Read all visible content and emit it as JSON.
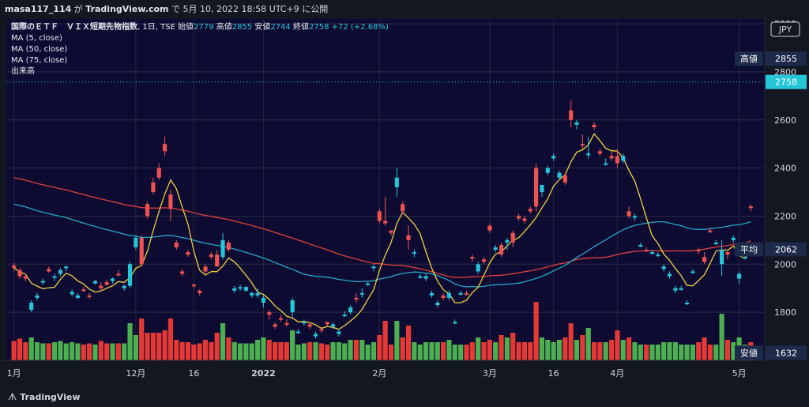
{
  "header": {
    "user": "masa117_114",
    "published_text_pre": "が",
    "site": "TradingView.com",
    "published_text_mid": "で",
    "datetime": "5月 10, 2022 18:58 UTC+9",
    "published_text_post": "に公開"
  },
  "legend": {
    "symbol": "国際のＥＴＦ　ＶＩＸ短期先物指数",
    "interval": "1日",
    "exchange": "TSE",
    "open_label": "始値",
    "open": "2779",
    "high_label": "高値",
    "high": "2855",
    "low_label": "安値",
    "low": "2744",
    "close_label": "終値",
    "close": "2758",
    "change": "+72 (+2.68%)",
    "ma_lines": [
      "MA (5, close)",
      "MA (50, close)",
      "MA (75, close)"
    ],
    "volume_label": "出来高"
  },
  "footer": {
    "brand": "TradingView"
  },
  "colors": {
    "bg": "#131722",
    "plot_bg": "#0e0b33",
    "up": "#26a69a",
    "up_candle": "#26c6da",
    "down": "#ef5350",
    "vol_up": "#4caf50",
    "vol_down": "#e53935",
    "ma5": "#f0d040",
    "ma50": "#26a6c9",
    "ma75": "#e0403c"
  },
  "chart_data": {
    "type": "candlestick",
    "title": "",
    "currency": "JPY",
    "y_ticks": [
      1800,
      2000,
      2200,
      2400,
      2600,
      2800,
      3000
    ],
    "ylim": [
      1600,
      3020
    ],
    "x_labels": [
      {
        "label": "1月",
        "index": 0
      },
      {
        "label": "12月",
        "index": 21
      },
      {
        "label": "16",
        "index": 31
      },
      {
        "label": "2022",
        "index": 43
      },
      {
        "label": "2月",
        "index": 63
      },
      {
        "label": "3月",
        "index": 82
      },
      {
        "label": "16",
        "index": 93
      },
      {
        "label": "4月",
        "index": 104
      },
      {
        "label": "5月",
        "index": 125
      }
    ],
    "candles": [
      [
        1995,
        2005,
        1970,
        1985,
        0
      ],
      [
        1975,
        1985,
        1940,
        1950,
        0
      ],
      [
        1950,
        1960,
        1930,
        1940,
        0
      ],
      [
        1840,
        1850,
        1800,
        1810,
        1
      ],
      [
        1870,
        1880,
        1850,
        1860,
        1
      ],
      [
        1925,
        1940,
        1915,
        1930,
        1
      ],
      [
        1980,
        1990,
        1965,
        1970,
        0
      ],
      [
        1945,
        1960,
        1930,
        1950,
        1
      ],
      [
        1960,
        1985,
        1950,
        1975,
        1
      ],
      [
        1985,
        1995,
        1970,
        1990,
        1
      ],
      [
        1885,
        1895,
        1865,
        1875,
        1
      ],
      [
        1870,
        1880,
        1855,
        1860,
        1
      ],
      [
        1895,
        1905,
        1885,
        1890,
        0
      ],
      [
        1870,
        1880,
        1855,
        1865,
        0
      ],
      [
        1920,
        1935,
        1915,
        1930,
        1
      ],
      [
        1910,
        1925,
        1890,
        1900,
        0
      ],
      [
        1925,
        1935,
        1910,
        1915,
        0
      ],
      [
        1930,
        1945,
        1920,
        1940,
        1
      ],
      [
        1960,
        1975,
        1950,
        1955,
        0
      ],
      [
        1900,
        1915,
        1890,
        1910,
        1
      ],
      [
        1910,
        2010,
        1900,
        2000,
        1
      ],
      [
        2070,
        2120,
        2060,
        2110,
        1
      ],
      [
        2110,
        2120,
        1990,
        2000,
        0
      ],
      [
        2200,
        2260,
        2190,
        2250,
        0
      ],
      [
        2300,
        2360,
        2290,
        2340,
        0
      ],
      [
        2360,
        2420,
        2350,
        2400,
        0
      ],
      [
        2500,
        2530,
        2450,
        2470,
        0
      ],
      [
        2230,
        2310,
        2180,
        2290,
        0
      ],
      [
        2090,
        2100,
        2060,
        2070,
        0
      ],
      [
        1970,
        1980,
        1950,
        1960,
        0
      ],
      [
        2050,
        2060,
        2030,
        2040,
        0
      ],
      [
        1910,
        1920,
        1900,
        1915,
        0
      ],
      [
        1880,
        1895,
        1870,
        1890,
        0
      ],
      [
        1990,
        2000,
        1960,
        1970,
        0
      ],
      [
        2040,
        2050,
        2020,
        2030,
        0
      ],
      [
        1990,
        2060,
        1990,
        2040,
        0
      ],
      [
        2100,
        2130,
        2020,
        2030,
        1
      ],
      [
        2090,
        2100,
        2050,
        2060,
        0
      ],
      [
        1900,
        1910,
        1880,
        1890,
        1
      ],
      [
        1905,
        1915,
        1890,
        1900,
        1
      ],
      [
        1905,
        1910,
        1885,
        1890,
        1
      ],
      [
        1880,
        1885,
        1860,
        1870,
        1
      ],
      [
        1880,
        1900,
        1860,
        1870,
        1
      ],
      [
        1860,
        1870,
        1820,
        1840,
        1
      ],
      [
        1790,
        1810,
        1770,
        1800,
        0
      ],
      [
        1740,
        1760,
        1730,
        1750,
        0
      ],
      [
        1770,
        1790,
        1760,
        1775,
        0
      ],
      [
        1750,
        1770,
        1740,
        1755,
        0
      ],
      [
        1850,
        1860,
        1780,
        1800,
        1
      ],
      [
        1720,
        1730,
        1710,
        1720,
        1
      ],
      [
        1760,
        1770,
        1745,
        1760,
        1
      ],
      [
        1740,
        1760,
        1730,
        1750,
        0
      ],
      [
        1700,
        1720,
        1690,
        1710,
        1
      ],
      [
        1730,
        1740,
        1715,
        1725,
        0
      ],
      [
        1750,
        1760,
        1740,
        1760,
        0
      ],
      [
        1750,
        1760,
        1730,
        1740,
        1
      ],
      [
        1720,
        1730,
        1700,
        1710,
        1
      ],
      [
        1790,
        1805,
        1780,
        1790,
        1
      ],
      [
        1800,
        1830,
        1790,
        1820,
        1
      ],
      [
        1860,
        1880,
        1840,
        1860,
        0
      ],
      [
        1880,
        1900,
        1860,
        1880,
        1
      ],
      [
        1920,
        1930,
        1910,
        1920,
        1
      ],
      [
        1990,
        2000,
        1970,
        1990,
        1
      ],
      [
        2180,
        2230,
        2170,
        2220,
        0
      ],
      [
        2170,
        2280,
        2160,
        2180,
        0
      ],
      [
        2130,
        2140,
        2120,
        2140,
        0
      ],
      [
        2360,
        2400,
        2280,
        2320,
        1
      ],
      [
        2250,
        2260,
        2210,
        2220,
        0
      ],
      [
        2120,
        2160,
        2060,
        2100,
        0
      ],
      [
        2050,
        2060,
        2030,
        2050,
        1
      ],
      [
        1950,
        1960,
        1940,
        1950,
        1
      ],
      [
        1950,
        1960,
        1930,
        1940,
        1
      ],
      [
        1870,
        1890,
        1860,
        1880,
        1
      ],
      [
        1840,
        1850,
        1820,
        1830,
        1
      ],
      [
        1860,
        1880,
        1850,
        1870,
        0
      ],
      [
        1880,
        1890,
        1850,
        1860,
        1
      ],
      [
        1760,
        1770,
        1750,
        1760,
        1
      ],
      [
        1880,
        1890,
        1870,
        1880,
        1
      ],
      [
        1880,
        1890,
        1870,
        1880,
        0
      ],
      [
        2030,
        2040,
        2010,
        2030,
        0
      ],
      [
        2000,
        2010,
        1960,
        1970,
        1
      ],
      [
        2020,
        2030,
        2000,
        2010,
        0
      ],
      [
        2160,
        2170,
        2130,
        2140,
        0
      ],
      [
        2070,
        2080,
        2050,
        2060,
        1
      ],
      [
        2040,
        2090,
        2030,
        2080,
        0
      ],
      [
        2100,
        2110,
        2060,
        2090,
        1
      ],
      [
        2090,
        2140,
        2070,
        2130,
        0
      ],
      [
        2200,
        2210,
        2180,
        2190,
        0
      ],
      [
        2180,
        2200,
        2170,
        2190,
        0
      ],
      [
        2230,
        2240,
        2210,
        2220,
        0
      ],
      [
        2400,
        2420,
        2220,
        2240,
        0
      ],
      [
        2300,
        2330,
        2280,
        2330,
        1
      ],
      [
        2400,
        2410,
        2370,
        2380,
        1
      ],
      [
        2440,
        2460,
        2430,
        2450,
        1
      ],
      [
        2380,
        2390,
        2350,
        2360,
        1
      ],
      [
        2370,
        2380,
        2330,
        2340,
        0
      ],
      [
        2640,
        2680,
        2570,
        2600,
        0
      ],
      [
        2590,
        2600,
        2560,
        2580,
        1
      ],
      [
        2500,
        2540,
        2480,
        2500,
        0
      ],
      [
        2460,
        2530,
        2440,
        2460,
        1
      ],
      [
        2580,
        2590,
        2560,
        2570,
        0
      ],
      [
        2470,
        2480,
        2450,
        2460,
        0
      ],
      [
        2420,
        2440,
        2410,
        2420,
        1
      ],
      [
        2440,
        2470,
        2430,
        2450,
        0
      ],
      [
        2420,
        2480,
        2400,
        2450,
        0
      ],
      [
        2450,
        2460,
        2420,
        2430,
        1
      ],
      [
        2220,
        2240,
        2190,
        2200,
        0
      ],
      [
        2200,
        2210,
        2180,
        2200,
        1
      ],
      [
        2080,
        2090,
        2070,
        2080,
        1
      ],
      [
        2060,
        2070,
        2050,
        2060,
        0
      ],
      [
        2050,
        2060,
        2040,
        2050,
        1
      ],
      [
        2040,
        2050,
        2030,
        2040,
        1
      ],
      [
        1990,
        2000,
        1970,
        1980,
        1
      ],
      [
        1960,
        1970,
        1940,
        1950,
        1
      ],
      [
        1900,
        1910,
        1880,
        1890,
        1
      ],
      [
        1900,
        1910,
        1890,
        1900,
        1
      ],
      [
        1840,
        1850,
        1830,
        1840,
        1
      ],
      [
        1970,
        1980,
        1960,
        1970,
        1
      ],
      [
        2060,
        2070,
        2040,
        2060,
        0
      ],
      [
        2030,
        2050,
        2000,
        2010,
        0
      ],
      [
        2140,
        2150,
        2130,
        2140,
        0
      ],
      [
        2090,
        2100,
        2080,
        2090,
        1
      ],
      [
        2060,
        2100,
        1950,
        2000,
        1
      ],
      [
        2040,
        2060,
        2020,
        2050,
        0
      ],
      [
        2110,
        2120,
        2090,
        2100,
        1
      ],
      [
        1960,
        1970,
        1920,
        1940,
        1
      ],
      [
        2030,
        2040,
        2020,
        2030,
        1
      ],
      [
        2240,
        2250,
        2220,
        2240,
        0
      ]
    ],
    "volumes": []
  }
}
